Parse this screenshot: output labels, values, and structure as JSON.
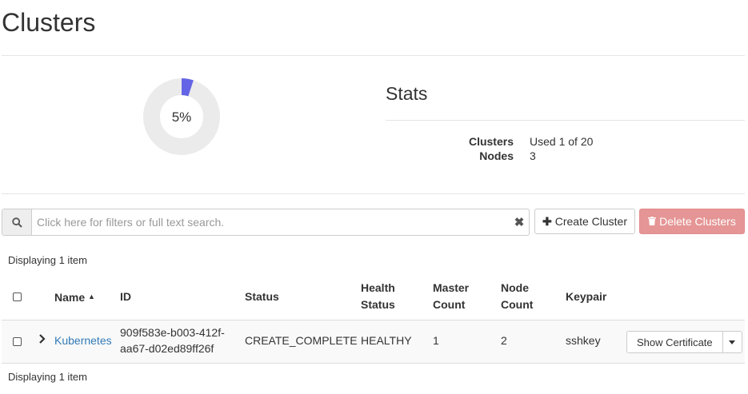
{
  "page": {
    "title": "Clusters"
  },
  "quota": {
    "percent_label": "5%",
    "used_fraction": 0.05,
    "used_color": "#6464e6",
    "track_color": "#ebebeb"
  },
  "stats": {
    "title": "Stats",
    "rows": [
      {
        "label": "Clusters",
        "value": "Used 1 of 20"
      },
      {
        "label": "Nodes",
        "value": "3"
      }
    ]
  },
  "toolbar": {
    "search_placeholder": "Click here for filters or full text search.",
    "search_icon": "search-icon",
    "clear_icon": "times-icon",
    "create_label": "Create Cluster",
    "delete_label": "Delete Clusters"
  },
  "table": {
    "displaying_top": "Displaying 1 item",
    "displaying_bottom": "Displaying 1 item",
    "headers": {
      "name": "Name",
      "id": "ID",
      "status": "Status",
      "health_status_1": "Health",
      "health_status_2": "Status",
      "master_count_1": "Master",
      "master_count_2": "Count",
      "node_count_1": "Node",
      "node_count_2": "Count",
      "keypair": "Keypair"
    },
    "rows": [
      {
        "name": "Kubernetes",
        "id_line1": "909f583e-b003-412f-",
        "id_line2": "aa67-d02ed89ff26f",
        "status": "CREATE_COMPLETE",
        "health_status": "HEALTHY",
        "master_count": "1",
        "node_count": "2",
        "keypair": "sshkey",
        "action_label": "Show Certificate"
      }
    ]
  },
  "colors": {
    "link": "#337ab7",
    "danger": "#e59595"
  }
}
